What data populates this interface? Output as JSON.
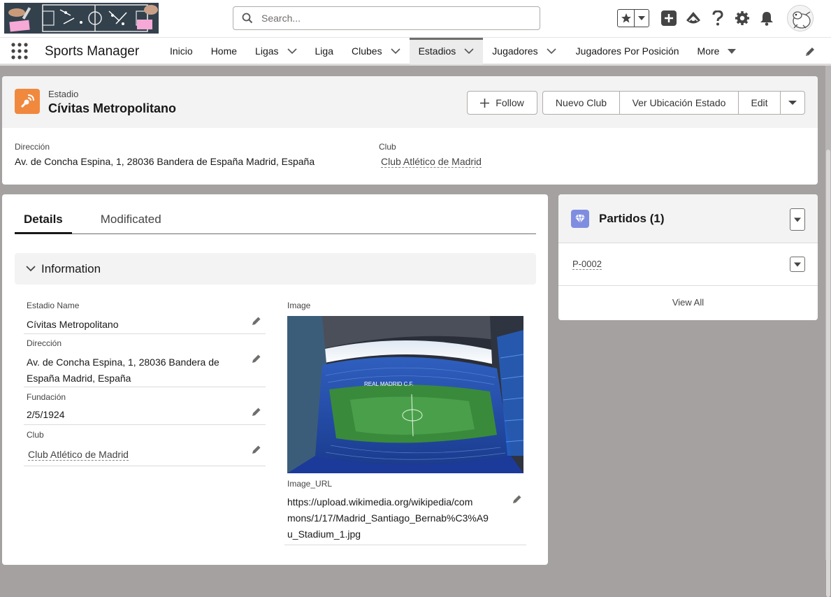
{
  "header": {
    "search_placeholder": "Search...",
    "icons": [
      "star-icon",
      "chevron-down-icon",
      "add-icon",
      "trailhead-icon",
      "help-icon",
      "setup-gear-icon",
      "notification-bell-icon"
    ]
  },
  "nav": {
    "app_name": "Sports Manager",
    "items": [
      {
        "label": "Inicio",
        "dropdown": false
      },
      {
        "label": "Home",
        "dropdown": false
      },
      {
        "label": "Ligas",
        "dropdown": true
      },
      {
        "label": "Liga",
        "dropdown": false
      },
      {
        "label": "Clubes",
        "dropdown": true
      },
      {
        "label": "Estadios",
        "dropdown": true,
        "active": true
      },
      {
        "label": "Jugadores",
        "dropdown": true
      },
      {
        "label": "Jugadores Por Posición",
        "dropdown": false
      },
      {
        "label": "More",
        "dropdown": true
      }
    ]
  },
  "record": {
    "object_type": "Estadio",
    "title": "Cívitas Metropolitano",
    "actions": {
      "follow": "Follow",
      "nuevo_club": "Nuevo Club",
      "ver_ubicacion": "Ver Ubicación Estado",
      "edit": "Edit"
    },
    "highlights": {
      "direccion_label": "Dirección",
      "direccion_value": "Av. de Concha Espina, 1, 28036 Bandera de España Madrid, España",
      "club_label": "Club",
      "club_value": "Club Atlético de Madrid"
    }
  },
  "details": {
    "tabs": [
      "Details",
      "Modificated"
    ],
    "section_title": "Information",
    "fields": {
      "estadio_name": {
        "label": "Estadio Name",
        "value": "Cívitas Metropolitano"
      },
      "direccion": {
        "label": "Dirección",
        "value_line1": "Av. de Concha Espina, 1, 28036 Bandera de",
        "value_line2": "España Madrid, España"
      },
      "fundacion": {
        "label": "Fundación",
        "value": "2/5/1924"
      },
      "club": {
        "label": "Club",
        "value": "Club Atlético de Madrid"
      },
      "image": {
        "label": "Image"
      },
      "image_url": {
        "label": "Image_URL",
        "line1": "https://upload.wikimedia.org/wikipedia/com",
        "line2": "mons/1/17/Madrid_Santiago_Bernab%C3%A9",
        "line3": "u_Stadium_1.jpg"
      }
    }
  },
  "related": {
    "title": "Partidos (1)",
    "items": [
      "P-0002"
    ],
    "view_all": "View All"
  },
  "colors": {
    "estadio_icon": "#f0893e",
    "partidos_icon": "#7f8de1",
    "page_background": "#a4a1a0",
    "active_tab_border": "#706e6b"
  }
}
